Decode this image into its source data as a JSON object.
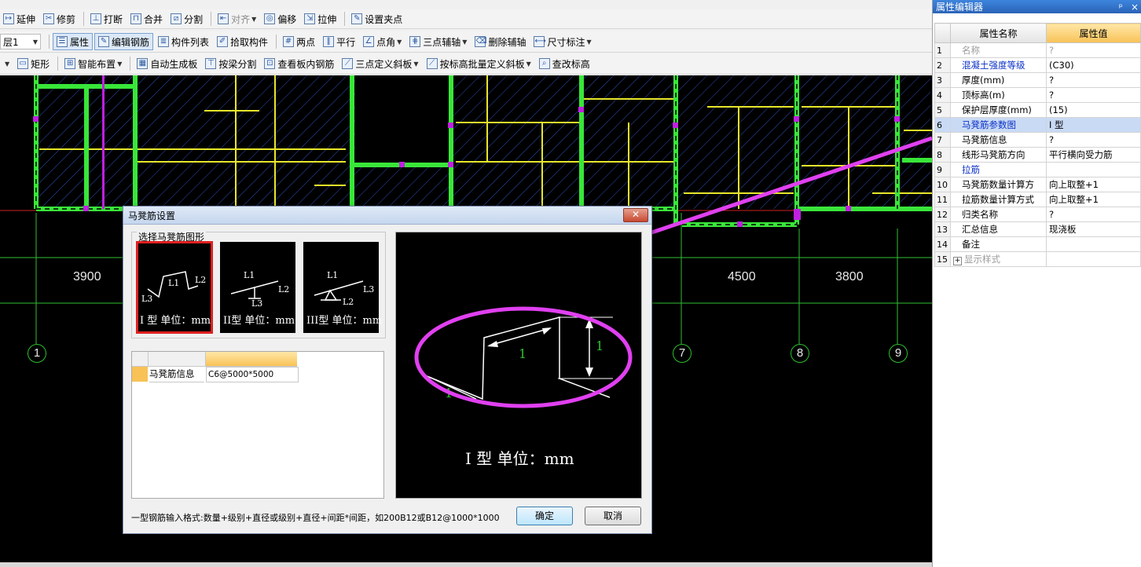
{
  "toolbar1": {
    "items": [
      "延伸",
      "修剪",
      "打断",
      "合并",
      "分割",
      "对齐",
      "偏移",
      "拉伸",
      "设置夹点"
    ]
  },
  "toolbar2": {
    "layer": "层1",
    "items": [
      "属性",
      "编辑钢筋",
      "构件列表",
      "拾取构件",
      "两点",
      "平行",
      "点角",
      "三点辅轴",
      "删除辅轴",
      "尺寸标注"
    ]
  },
  "toolbar3": {
    "items": [
      "矩形",
      "智能布置",
      "自动生成板",
      "按梁分割",
      "查看板内钢筋",
      "三点定义斜板",
      "按标高批量定义斜板",
      "查改标高"
    ]
  },
  "canvas": {
    "dimensions": [
      "3900",
      "4500",
      "3800"
    ],
    "axes": [
      "1",
      "7",
      "8",
      "9"
    ]
  },
  "dialog": {
    "title": "马凳筋设置",
    "group_label": "选择马凳筋图形",
    "shapes": [
      {
        "labels": [
          "L1",
          "L2",
          "L3"
        ],
        "caption": "I 型 单位：mm"
      },
      {
        "labels": [
          "L1",
          "L2",
          "L3"
        ],
        "caption": "II型 单位：mm"
      },
      {
        "labels": [
          "L1",
          "L3",
          "L2"
        ],
        "caption": "III型 单位：mm"
      }
    ],
    "grid": {
      "row_label": "马凳筋信息",
      "row_value": "C6@5000*5000"
    },
    "preview": {
      "caption": "I 型 单位：mm",
      "dims": [
        "1",
        "1",
        "1"
      ]
    },
    "hint": "一型钢筋输入格式:数量+级别+直径或级别+直径+间距*间距，如200B12或B12@1000*1000",
    "ok": "确定",
    "cancel": "取消"
  },
  "property_editor": {
    "title": "属性编辑器",
    "pin": "ᵖ",
    "close": "×",
    "col_name": "属性名称",
    "col_value": "属性值",
    "rows": [
      {
        "no": "1",
        "name": "名称",
        "value": "?"
      },
      {
        "no": "2",
        "name": "混凝土强度等级",
        "value": "(C30)"
      },
      {
        "no": "3",
        "name": "厚度(mm)",
        "value": "?"
      },
      {
        "no": "4",
        "name": "顶标高(m)",
        "value": "?"
      },
      {
        "no": "5",
        "name": "保护层厚度(mm)",
        "value": "(15)"
      },
      {
        "no": "6",
        "name": "马凳筋参数图",
        "value": "I 型"
      },
      {
        "no": "7",
        "name": "马凳筋信息",
        "value": "?"
      },
      {
        "no": "8",
        "name": "线形马凳筋方向",
        "value": "平行横向受力筋"
      },
      {
        "no": "9",
        "name": "拉筋",
        "value": ""
      },
      {
        "no": "10",
        "name": "马凳筋数量计算方",
        "value": "向上取整+1"
      },
      {
        "no": "11",
        "name": "拉筋数量计算方式",
        "value": "向上取整+1"
      },
      {
        "no": "12",
        "name": "归类名称",
        "value": "?"
      },
      {
        "no": "13",
        "name": "汇总信息",
        "value": "现浇板"
      },
      {
        "no": "14",
        "name": "备注",
        "value": ""
      },
      {
        "no": "15",
        "name": "显示样式",
        "value": ""
      }
    ]
  },
  "colors": {
    "accent_title": "#2a64b8",
    "highlight_row": "#c9daf5",
    "annotation": "#e040f0",
    "wall": "#39e639",
    "beam": "#e6e62a"
  }
}
